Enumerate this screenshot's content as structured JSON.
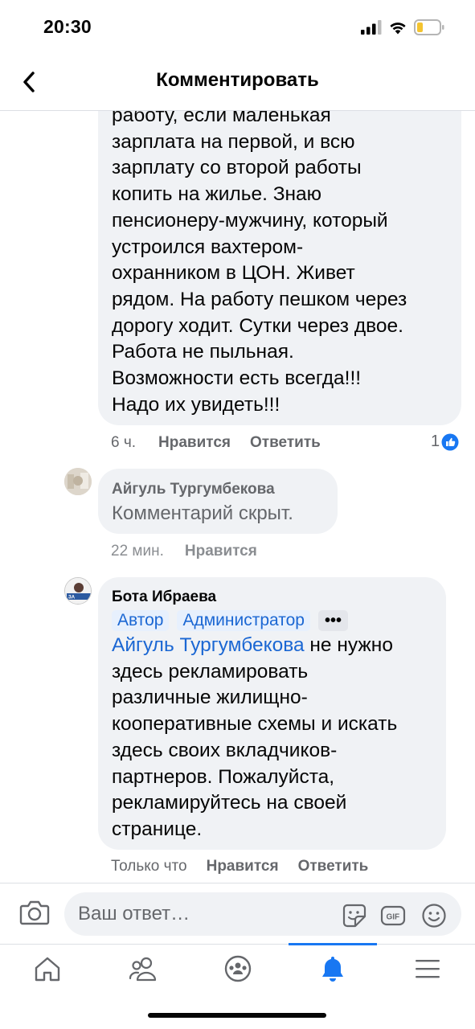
{
  "status_bar": {
    "time": "20:30"
  },
  "header": {
    "title": "Комментировать"
  },
  "comment1": {
    "lines": [
      "работу, если маленькая",
      "зарплата на первой, и всю",
      "зарплату со второй работы",
      "копить на жилье. Знаю",
      "пенсионеру-мужчину, который",
      "устроился вахтером-",
      "охранником в ЦОН. Живет",
      "рядом. На работу пешком через",
      "дорогу ходит. Сутки через двое.",
      "Работа не пыльная.",
      "Возможности есть всегда!!!",
      "Надо их увидеть!!!"
    ],
    "time": "6 ч.",
    "like": "Нравится",
    "reply": "Ответить",
    "reactions_count": "1"
  },
  "comment2": {
    "author": "Айгуль Тургумбекова",
    "text": "Комментарий скрыт.",
    "time": "22 мин.",
    "like": "Нравится"
  },
  "comment3": {
    "author": "Бота Ибраева",
    "badges": [
      "Автор",
      "Администратор"
    ],
    "more": "•••",
    "mention": "Айгуль Тургумбекова",
    "lines": [
      " не нужно",
      "здесь рекламировать",
      "различные жилищно-",
      "кооперативные схемы и искать",
      "здесь своих вкладчиков-",
      "партнеров. Пожалуйста,",
      "рекламируйтесь на своей",
      "странице."
    ],
    "time": "Только что",
    "like": "Нравится",
    "reply": "Ответить"
  },
  "composer": {
    "placeholder": "Ваш ответ…"
  },
  "icons": {
    "back": "chevron-left-icon",
    "camera": "camera-icon",
    "sticker": "sticker-icon",
    "gif": "gif-icon",
    "emoji": "emoji-icon",
    "home": "home-icon",
    "friends": "friends-icon",
    "groups": "groups-icon",
    "notifications": "bell-icon",
    "menu": "menu-icon"
  },
  "colors": {
    "accent": "#1877f2",
    "link": "#1b67d3",
    "bubble": "#f0f2f5",
    "muted": "#65676b"
  }
}
